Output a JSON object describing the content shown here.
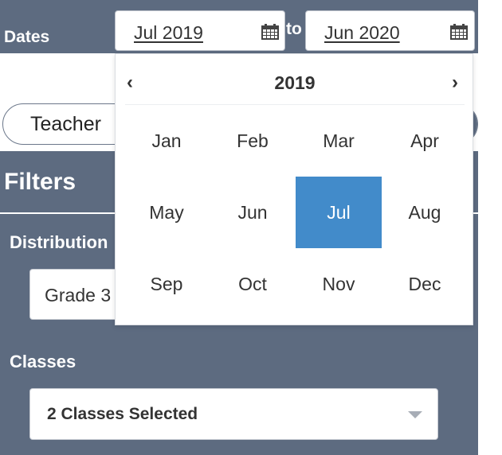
{
  "dates": {
    "label": "Dates",
    "to_label": "to",
    "start_value": "Jul 2019",
    "end_value": "Jun 2020",
    "calendar_icon": "calendar-icon"
  },
  "segment": {
    "label": "Teacher"
  },
  "filters": {
    "title": "Filters",
    "distribution": {
      "label": "Distribution",
      "value": "Grade 3"
    },
    "classes": {
      "label": "Classes",
      "value": "2 Classes Selected",
      "caret_icon": "caret-down-icon"
    }
  },
  "picker": {
    "year": "2019",
    "prev_icon": "chevron-left-icon",
    "next_icon": "chevron-right-icon",
    "months": [
      "Jan",
      "Feb",
      "Mar",
      "Apr",
      "May",
      "Jun",
      "Jul",
      "Aug",
      "Sep",
      "Oct",
      "Nov",
      "Dec"
    ],
    "selected_month": "Jul"
  },
  "colors": {
    "sidebar": "#5d6b80",
    "selected": "#428bca",
    "text": "#333333"
  }
}
